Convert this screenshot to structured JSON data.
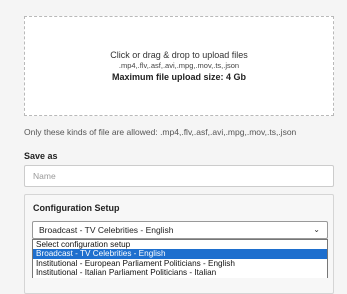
{
  "upload": {
    "instruction": "Click or drag & drop to upload files",
    "types": ".mp4,.flv,.asf,.avi,.mpg,.mov,.ts,.json",
    "max_size": "Maximum file upload size: 4 Gb"
  },
  "allowed_text": "Only these kinds of file are allowed: .mp4,.flv,.asf,.avi,.mpg,.mov,.ts,.json",
  "save_as": {
    "label": "Save as",
    "placeholder": "Name",
    "value": ""
  },
  "config": {
    "title": "Configuration Setup",
    "selected": "Broadcast - TV Celebrities - English",
    "options": [
      "Select configuration setup",
      "Broadcast - TV Celebrities - English",
      "Institutional - European Parliament Politicians - English",
      "Institutional - Italian Parliament Politicians - Italian"
    ],
    "highlighted_index": 1
  },
  "icons": {
    "select_chevron": "chevron-down-icon"
  }
}
